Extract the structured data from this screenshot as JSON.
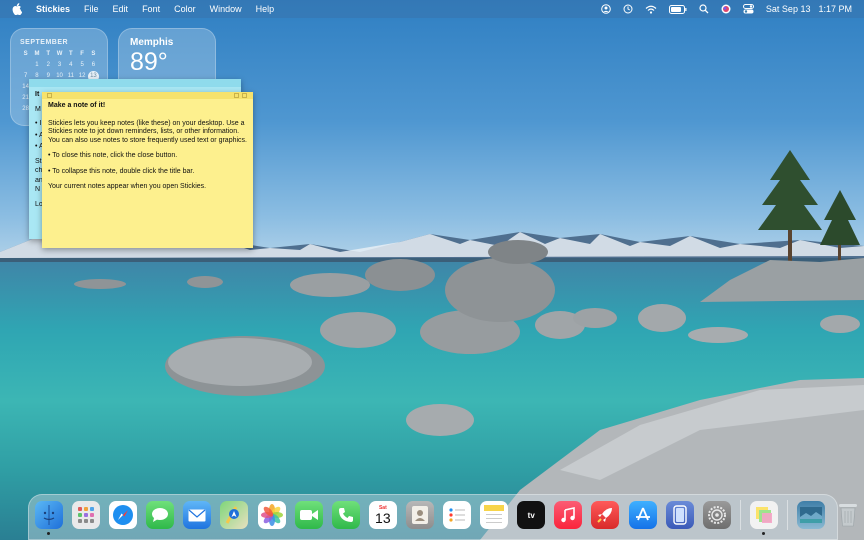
{
  "menubar": {
    "app_name": "Stickies",
    "menus": [
      "File",
      "Edit",
      "Font",
      "Color",
      "Window",
      "Help"
    ],
    "date": "Sat Sep 13",
    "time": "1:17 PM",
    "status_icons": [
      "user-icon",
      "clock-icon",
      "wifi-icon",
      "battery-icon",
      "search-icon",
      "siri-icon",
      "control-center-icon"
    ]
  },
  "calendar_widget": {
    "month": "SEPTEMBER",
    "weekdays": [
      "S",
      "M",
      "T",
      "W",
      "T",
      "F",
      "S"
    ],
    "row1": [
      "1",
      "2",
      "3",
      "4",
      "5",
      "6"
    ],
    "row2": [
      "7",
      "8",
      "9",
      "10",
      "11",
      "12",
      "13"
    ],
    "row3_start": "14",
    "row4_start": "21",
    "row5_start": "28",
    "today": "13"
  },
  "weather_widget": {
    "city": "Memphis",
    "temperature": "89°"
  },
  "sticky_back": {
    "lines": [
      "It",
      "M",
      "• I",
      "• A",
      "• A",
      "St",
      "ch",
      "an",
      "N",
      "Lo"
    ]
  },
  "sticky_front": {
    "title": "Make a note of it!",
    "para1": "Stickies lets you keep notes (like these) on your desktop. Use a Stickies note to jot down reminders, lists, or other information. You can also use notes to store frequently used text or graphics.",
    "para2": "• To close this note, click the close button.",
    "para3": "• To collapse this note, double click the title bar.",
    "para4": "Your current notes appear when you open Stickies."
  },
  "dock": {
    "apps": [
      "finder-icon",
      "launchpad-icon",
      "safari-icon",
      "messages-icon",
      "mail-icon",
      "maps-icon",
      "photos-icon",
      "facetime-icon",
      "phone-icon",
      "calendar-icon",
      "contacts-icon",
      "reminders-icon",
      "notes-icon",
      "tv-icon",
      "music-icon",
      "rocket-icon",
      "app-store-icon",
      "iphone-mirroring-icon",
      "system-settings-icon",
      "stickies-icon",
      "downloads-icon",
      "trash-icon"
    ],
    "calendar_icon_month": "Sat",
    "calendar_icon_day": "13",
    "tv_label": "tv"
  }
}
